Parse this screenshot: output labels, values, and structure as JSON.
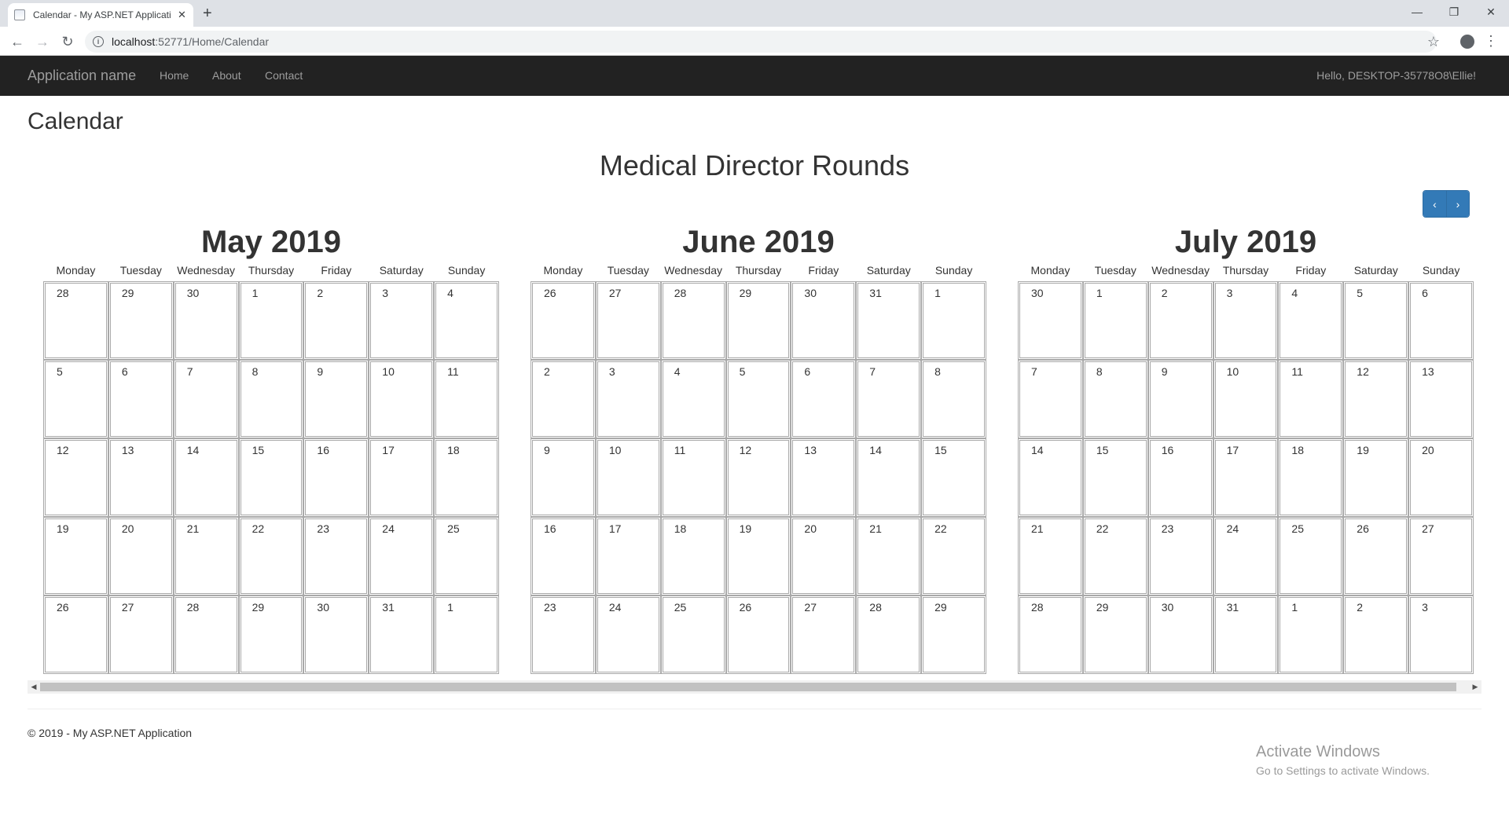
{
  "browser": {
    "tab_title": "Calendar - My ASP.NET Applicati",
    "tab_close": "✕",
    "new_tab": "+",
    "url_host": "localhost",
    "url_path": ":52771/Home/Calendar",
    "controls": {
      "minimize": "—",
      "restore": "❐",
      "close": "✕"
    },
    "back": "←",
    "forward": "→",
    "reload": "↻",
    "star": "☆",
    "menu": "⋮",
    "info": "i"
  },
  "navbar": {
    "brand": "Application name",
    "links": [
      "Home",
      "About",
      "Contact"
    ],
    "greeting": "Hello, DESKTOP-35778O8\\Ellie!"
  },
  "page": {
    "title": "Calendar",
    "heading": "Medical Director Rounds",
    "prev": "‹",
    "next": "›"
  },
  "weekdays": [
    "Monday",
    "Tuesday",
    "Wednesday",
    "Thursday",
    "Friday",
    "Saturday",
    "Sunday"
  ],
  "months": [
    {
      "title": "May 2019",
      "days": [
        "28",
        "29",
        "30",
        "1",
        "2",
        "3",
        "4",
        "5",
        "6",
        "7",
        "8",
        "9",
        "10",
        "11",
        "12",
        "13",
        "14",
        "15",
        "16",
        "17",
        "18",
        "19",
        "20",
        "21",
        "22",
        "23",
        "24",
        "25",
        "26",
        "27",
        "28",
        "29",
        "30",
        "31",
        "1"
      ]
    },
    {
      "title": "June 2019",
      "days": [
        "26",
        "27",
        "28",
        "29",
        "30",
        "31",
        "1",
        "2",
        "3",
        "4",
        "5",
        "6",
        "7",
        "8",
        "9",
        "10",
        "11",
        "12",
        "13",
        "14",
        "15",
        "16",
        "17",
        "18",
        "19",
        "20",
        "21",
        "22",
        "23",
        "24",
        "25",
        "26",
        "27",
        "28",
        "29"
      ]
    },
    {
      "title": "July 2019",
      "days": [
        "30",
        "1",
        "2",
        "3",
        "4",
        "5",
        "6",
        "7",
        "8",
        "9",
        "10",
        "11",
        "12",
        "13",
        "14",
        "15",
        "16",
        "17",
        "18",
        "19",
        "20",
        "21",
        "22",
        "23",
        "24",
        "25",
        "26",
        "27",
        "28",
        "29",
        "30",
        "31",
        "1",
        "2",
        "3"
      ]
    }
  ],
  "scrollbar": {
    "left": "◀",
    "right": "▶"
  },
  "footer": "© 2019 - My ASP.NET Application",
  "watermark": {
    "line1": "Activate Windows",
    "line2": "Go to Settings to activate Windows."
  }
}
